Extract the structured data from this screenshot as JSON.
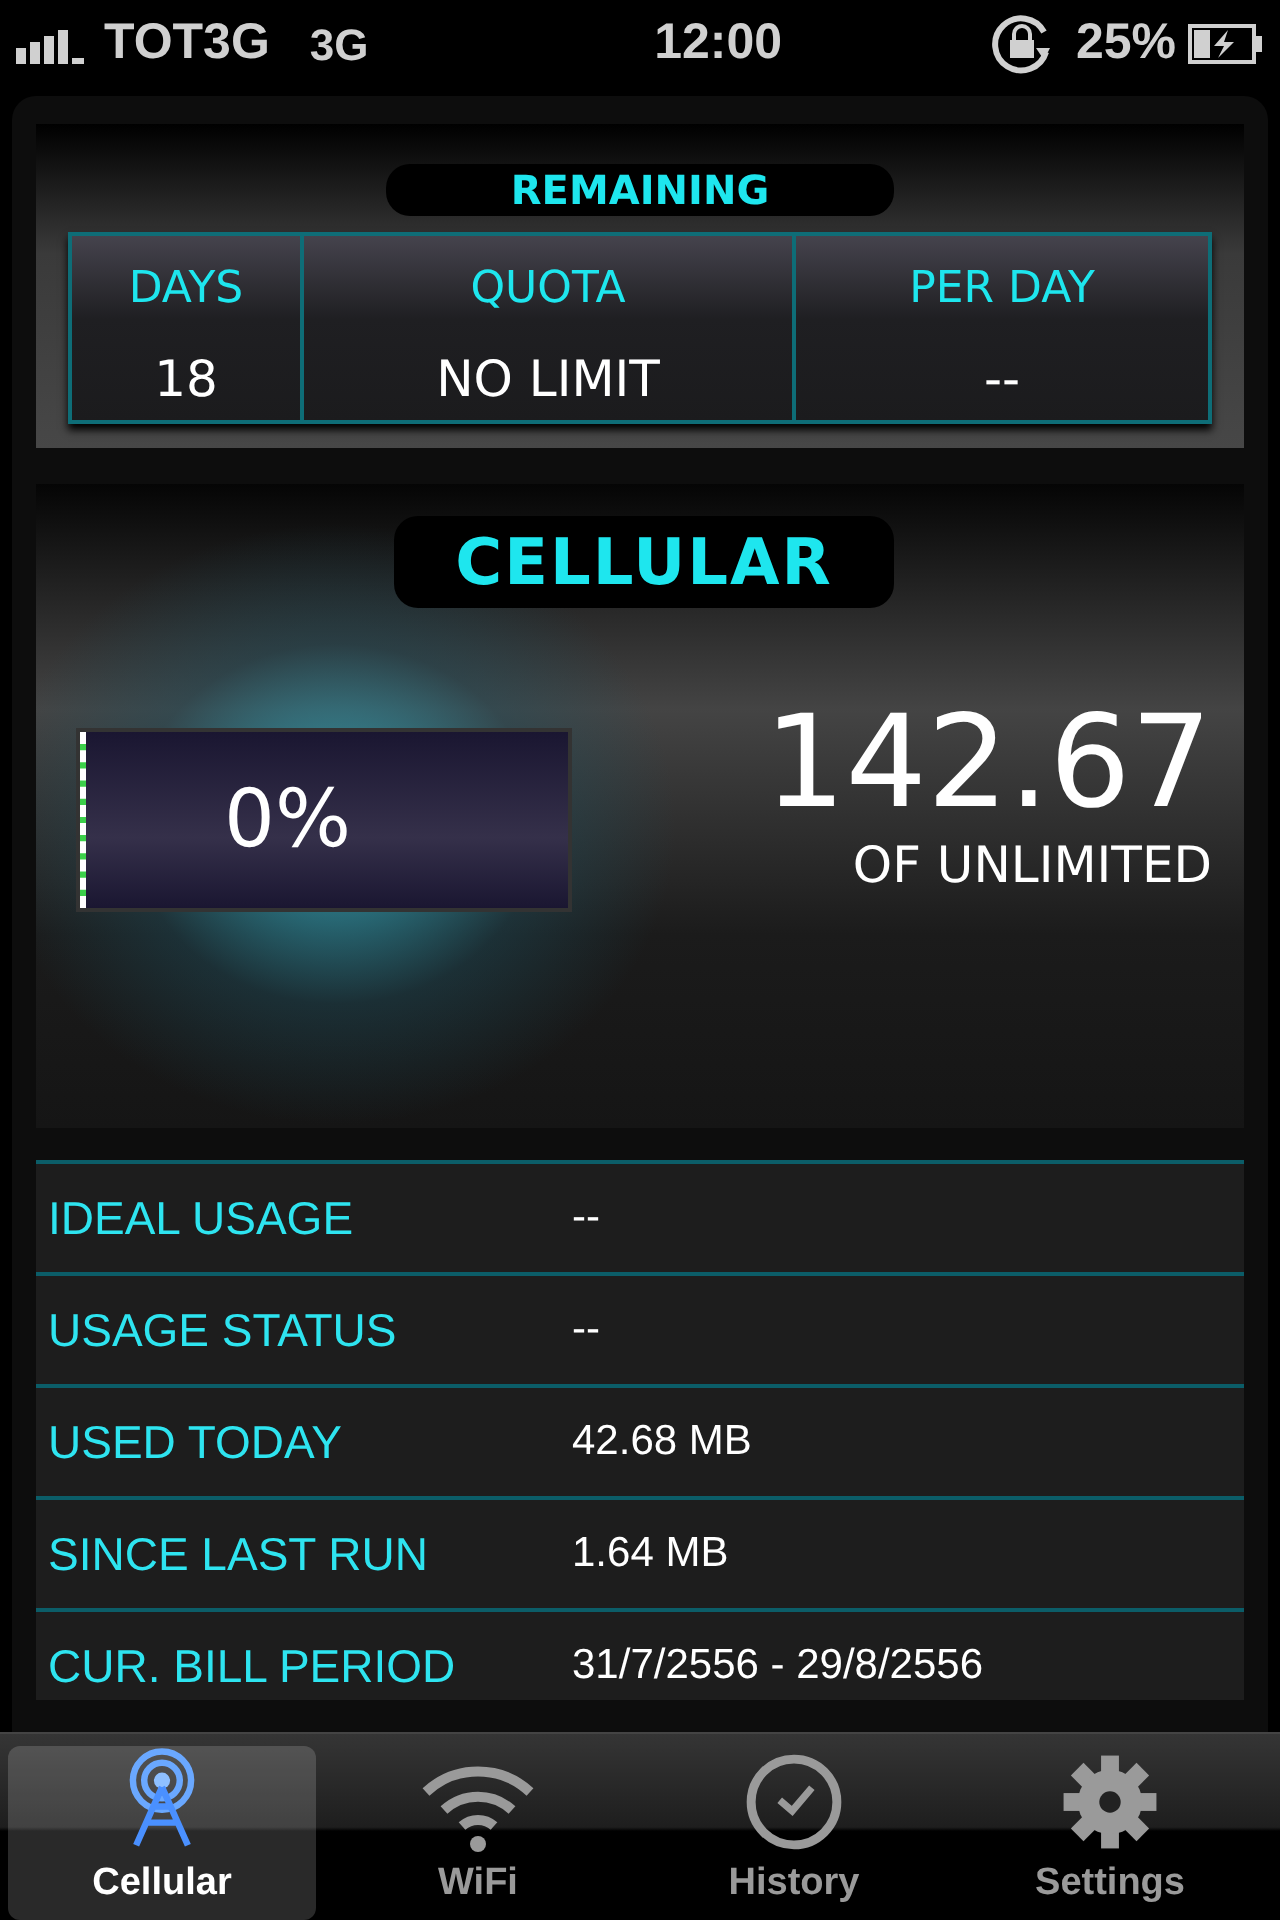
{
  "status_bar": {
    "carrier": "TOT3G",
    "network": "3G",
    "time": "12:00",
    "battery": "25%"
  },
  "remaining": {
    "title": "REMAINING",
    "columns": [
      {
        "label": "DAYS",
        "value": "18"
      },
      {
        "label": "QUOTA",
        "value": "NO LIMIT"
      },
      {
        "label": "PER DAY",
        "value": "--"
      }
    ]
  },
  "cellular": {
    "title": "CELLULAR",
    "meter": {
      "level": 0,
      "reading": "0%"
    },
    "amount": "142.67",
    "of": "OF UNLIMITED"
  },
  "details": [
    {
      "label": "IDEAL USAGE",
      "value": "--"
    },
    {
      "label": "USAGE STATUS",
      "value": "--"
    },
    {
      "label": "USED TODAY",
      "value": "42.68 MB"
    },
    {
      "label": "SINCE LAST RUN",
      "value": "1.64 MB"
    },
    {
      "label": "CUR. BILL PERIOD",
      "value": "31/7/2556 - 29/8/2556"
    }
  ],
  "tabs": [
    {
      "kind": "cellular",
      "label": "Cellular",
      "selected": true
    },
    {
      "kind": "wifi",
      "label": "WiFi",
      "selected": false
    },
    {
      "kind": "history",
      "label": "History",
      "selected": false
    },
    {
      "kind": "settings",
      "label": "Settings",
      "selected": false
    }
  ]
}
